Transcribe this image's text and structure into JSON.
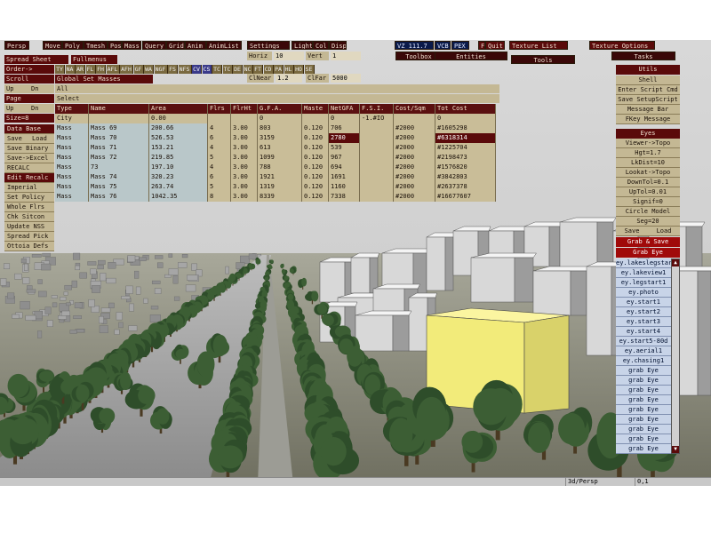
{
  "menubar": {
    "items": [
      "Persp",
      "Move",
      "Poly",
      "Tmesh",
      "Pos",
      "Mass",
      "Query",
      "Grid",
      "Anim",
      "AnimList",
      "Settings",
      "Light",
      "Col",
      "Disp"
    ],
    "vz": "VZ 111.7",
    "vcb": "VCB",
    "pex": "PEX",
    "f": "F",
    "quit": "Quit",
    "texture_list": "Texture List",
    "texture_options": "Texture Options"
  },
  "row2": {
    "horiz_label": "Horiz",
    "horiz_value": "10",
    "vert_label": "Vert",
    "vert_value": "1",
    "toolbox": "Toolbox",
    "entities": "Entities",
    "tools": "Tools",
    "tasks": "Tasks"
  },
  "clip": {
    "near_label": "ClNear",
    "near_value": "1.2",
    "far_label": "ClFar",
    "far_value": "5000"
  },
  "spreadsheet": {
    "title": "Spread Sheet",
    "fullmenus": "Fullmenus",
    "order": "Order->",
    "scroll": "Scroll",
    "global_set": "Global Set Masses",
    "tool_buttons": [
      "TY",
      "NA",
      "AR",
      "FL",
      "FH",
      "AFL",
      "AFH",
      "GF",
      "WA",
      "NGF",
      "FS",
      "NFS",
      "CV",
      "CS",
      "TC",
      "TC",
      "DE",
      "NC",
      "FT",
      "CD",
      "PA",
      "HL",
      "HO",
      "SE"
    ],
    "up": "Up",
    "dn": "Dn",
    "all": "All",
    "select": "Select",
    "page": "Page",
    "size": "Size=8",
    "columns": [
      "Type",
      "Name",
      "Area",
      "Flrs",
      "FlrHt",
      "G.F.A.",
      "Maste",
      "NetGFA",
      "F.S.I.",
      "Cost/Sqm",
      "Tot Cost"
    ],
    "city_row": [
      "City",
      "",
      "0.00",
      "",
      "",
      "0",
      "",
      "0",
      "-1.#IO",
      "",
      "0"
    ],
    "rows": [
      [
        "Mass",
        "Mass 69",
        "200.66",
        "4",
        "3.00",
        "803",
        "0.120",
        "706",
        "",
        "2000",
        "1605298"
      ],
      [
        "Mass",
        "Mass 70",
        "526.53",
        "6",
        "3.00",
        "3159",
        "0.120",
        "2780",
        "",
        "2000",
        "6318314"
      ],
      [
        "Mass",
        "Mass 71",
        "153.21",
        "4",
        "3.00",
        "613",
        "0.120",
        "539",
        "",
        "2000",
        "1225704"
      ],
      [
        "Mass",
        "Mass 72",
        "219.85",
        "5",
        "3.00",
        "1099",
        "0.120",
        "967",
        "",
        "2000",
        "2198473"
      ],
      [
        "Mass",
        "73",
        "197.10",
        "4",
        "3.00",
        "788",
        "0.120",
        "694",
        "",
        "2000",
        "1576820"
      ],
      [
        "Mass",
        "Mass 74",
        "320.23",
        "6",
        "3.00",
        "1921",
        "0.120",
        "1691",
        "",
        "2000",
        "3842803"
      ],
      [
        "Mass",
        "Mass 75",
        "263.74",
        "5",
        "3.00",
        "1319",
        "0.120",
        "1160",
        "",
        "2000",
        "2637378"
      ],
      [
        "Mass",
        "Mass 76",
        "1042.35",
        "8",
        "3.00",
        "8339",
        "0.120",
        "7338",
        "",
        "2000",
        "16677607"
      ]
    ],
    "left_buttons": [
      "Data Base",
      "Save",
      "Load",
      "Save Binary",
      "Save->Excel",
      "RECALC",
      "Edit Recalc",
      "Imperial",
      "Set Policy",
      "Whole Flrs",
      "Chk Sitcon",
      "Update NSS",
      "Spread Pick",
      "Ottoia Defs"
    ]
  },
  "right_panel": {
    "utils": "Utils",
    "shell": "Shell",
    "enter_script": "Enter Script Cmd",
    "save_setup": "Save SetupScript",
    "message_bar": "Message Bar",
    "fkey": "FKey Message",
    "eyes": "Eyes",
    "viewer_topo": "Viewer->Topo",
    "hgt": "Hgt=1.7",
    "lkdist": "LkDist=10",
    "lookat_topo": "Lookat->Topo",
    "downtol": "DownTol=0.1",
    "uptol": "UpTol=0.01",
    "signif": "Signif=0",
    "circle_model": "Circle Model",
    "seg": "Seg=20",
    "save": "Save",
    "load": "Load",
    "grab_save": "Grab & Save",
    "grab_eye": "Grab Eye",
    "eye_list": [
      "ey.lakeslegstart1",
      "ey.lakeview1",
      "ey.legstart1",
      "ey.photo",
      "ey.start1",
      "ey.start2",
      "ey.start3",
      "ey.start4",
      "ey.start5-80d",
      "ey.aerial1",
      "ey.chasing1",
      "grab Eye",
      "grab Eye",
      "grab Eye",
      "grab Eye",
      "grab Eye",
      "grab Eye",
      "grab Eye",
      "grab Eye",
      "grab Eye"
    ]
  },
  "statusbar": {
    "mode": "3d/Persp",
    "value": "0,1"
  },
  "colors": {
    "maroon": "#5a0a0a",
    "tan": "#c4b894",
    "highlight_yellow": "#f2eb7a",
    "tree_green": "#2e4d2a"
  }
}
